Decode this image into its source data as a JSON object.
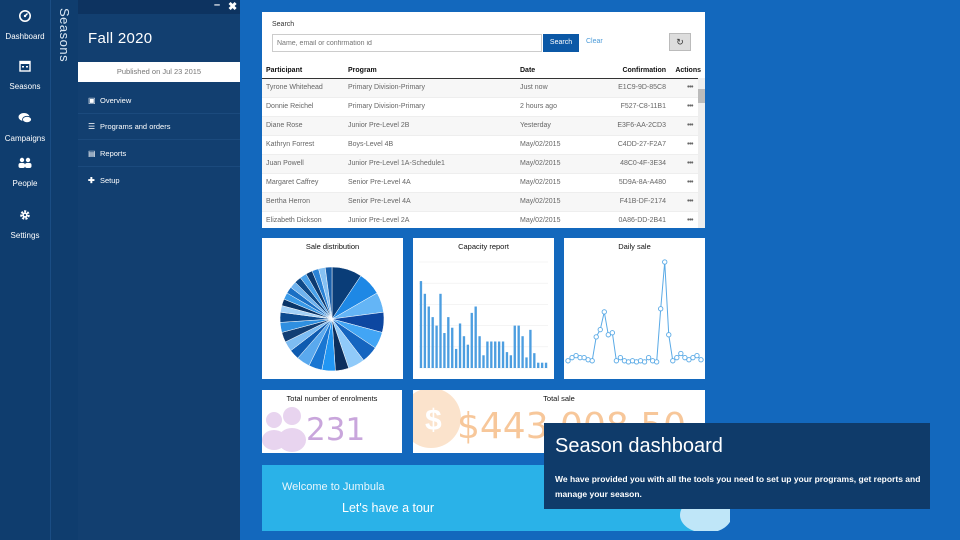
{
  "rail": {
    "items": [
      {
        "label": "Dashboard",
        "icon": "dashboard-icon"
      },
      {
        "label": "Seasons",
        "icon": "calendar-icon"
      },
      {
        "label": "Campaigns",
        "icon": "chat-icon"
      },
      {
        "label": "People",
        "icon": "people-icon"
      },
      {
        "label": "Settings",
        "icon": "gear-icon"
      }
    ]
  },
  "strip": {
    "label": "Seasons"
  },
  "panel": {
    "title": "Fall 2020",
    "published": "Published on Jul 23 2015",
    "nav": [
      {
        "label": "Overview",
        "icon": "overview-icon"
      },
      {
        "label": "Programs and orders",
        "icon": "list-icon"
      },
      {
        "label": "Reports",
        "icon": "reports-icon"
      },
      {
        "label": "Setup",
        "icon": "plus-icon"
      }
    ]
  },
  "search": {
    "label": "Search",
    "placeholder": "Name, email or confirmation id",
    "button": "Search",
    "clear": "Clear"
  },
  "table": {
    "columns": [
      "Participant",
      "Program",
      "Date",
      "Confirmation",
      "Actions"
    ],
    "rows": [
      [
        "Tyrone Whitehead",
        "Primary Division-Primary",
        "Just now",
        "E1C9-9D-85C8",
        "•••"
      ],
      [
        "Donnie Reichel",
        "Primary Division-Primary",
        "2 hours ago",
        "F527-C8-11B1",
        "•••"
      ],
      [
        "Diane Rose",
        "Junior Pre-Level 2B",
        "Yesterday",
        "E3F6-AA-2CD3",
        "•••"
      ],
      [
        "Kathryn Forrest",
        "Boys-Level 4B",
        "May/02/2015",
        "C4DD-27-F2A7",
        "•••"
      ],
      [
        "Juan Powell",
        "Junior Pre-Level 1A-Schedule1",
        "May/02/2015",
        "48C0-4F-3E34",
        "•••"
      ],
      [
        "Margaret Caffrey",
        "Senior Pre-Level 4A",
        "May/02/2015",
        "5D9A-8A-A480",
        "•••"
      ],
      [
        "Bertha Herron",
        "Senior Pre-Level 4A",
        "May/02/2015",
        "F41B-DF-2174",
        "•••"
      ],
      [
        "Elizabeth Dickson",
        "Junior Pre-Level 2A",
        "May/02/2015",
        "0A86-DD-2B41",
        "•••"
      ]
    ]
  },
  "cards": {
    "sale_distribution": "Sale distribution",
    "capacity_report": "Capacity report",
    "daily_sale": "Daily sale",
    "enrolments_title": "Total number of enrolments",
    "enrolments_value": "231",
    "total_sale_title": "Total sale",
    "total_sale_value": "$443,008.50"
  },
  "welcome": {
    "text": "Welcome to Jumbula",
    "tour": "Let's have a tour"
  },
  "tooltip": {
    "title": "Season dashboard",
    "body": "We have provided you with all the tools you need to set up your programs, get reports and manage your season."
  },
  "chart_data": [
    {
      "type": "pie",
      "title": "Sale distribution",
      "values": [
        9,
        7,
        6,
        6,
        5,
        5,
        5,
        4,
        4,
        4,
        4,
        3,
        3,
        3,
        3,
        3,
        2,
        2,
        2,
        2,
        2,
        2,
        2,
        2,
        2,
        2,
        2
      ],
      "colors": [
        "#0a3d78",
        "#1e88e5",
        "#64b5f6",
        "#0d47a1",
        "#42a5f5",
        "#1565c0",
        "#90caf9",
        "#0b2f5e",
        "#2196f3",
        "#1976d2",
        "#5aa9ee",
        "#0e5bb0",
        "#7dbcf2",
        "#123e74",
        "#2f8fe0",
        "#0d4b8f",
        "#a3d1f7",
        "#0a3568",
        "#3a9ae8",
        "#1a6fc4",
        "#6fb3ef",
        "#104a88",
        "#4aa2ea",
        "#0c3a70",
        "#2b83d6",
        "#86c1f3",
        "#185fab"
      ]
    },
    {
      "type": "bar",
      "title": "Capacity report",
      "ylim": [
        0,
        100
      ],
      "values": [
        82,
        70,
        58,
        48,
        40,
        70,
        33,
        48,
        38,
        18,
        42,
        30,
        22,
        52,
        58,
        30,
        12,
        25,
        25,
        25,
        25,
        25,
        15,
        12,
        40,
        40,
        30,
        10,
        36,
        14,
        5,
        5,
        5
      ]
    },
    {
      "type": "line",
      "title": "Daily sale",
      "ylim": [
        0,
        100
      ],
      "values": [
        5,
        8,
        10,
        8,
        8,
        6,
        5,
        28,
        35,
        52,
        30,
        32,
        5,
        8,
        5,
        4,
        5,
        4,
        5,
        4,
        8,
        5,
        4,
        55,
        100,
        30,
        5,
        8,
        12,
        8,
        6,
        8,
        10,
        6
      ]
    }
  ]
}
